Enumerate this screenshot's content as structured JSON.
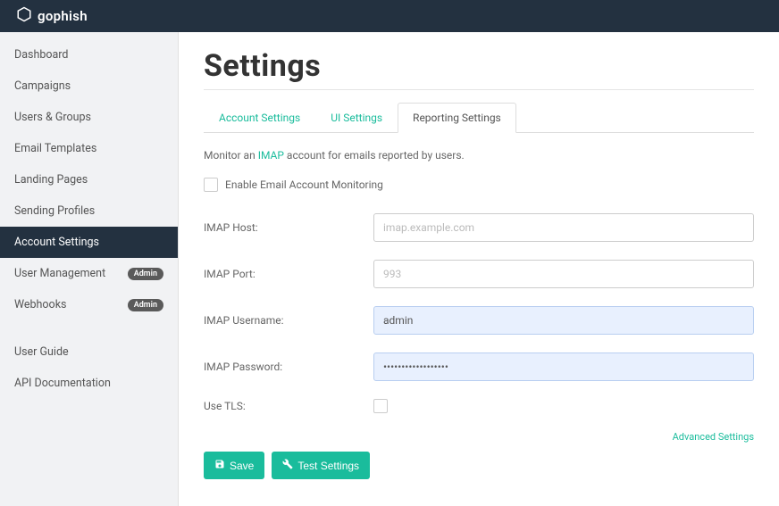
{
  "brand": "gophish",
  "sidebar": {
    "items": [
      {
        "label": "Dashboard"
      },
      {
        "label": "Campaigns"
      },
      {
        "label": "Users & Groups"
      },
      {
        "label": "Email Templates"
      },
      {
        "label": "Landing Pages"
      },
      {
        "label": "Sending Profiles"
      },
      {
        "label": "Account Settings"
      },
      {
        "label": "User Management",
        "badge": "Admin"
      },
      {
        "label": "Webhooks",
        "badge": "Admin"
      },
      {
        "label": "User Guide"
      },
      {
        "label": "API Documentation"
      }
    ]
  },
  "page": {
    "title": "Settings"
  },
  "tabs": [
    {
      "label": "Account Settings"
    },
    {
      "label": "UI Settings"
    },
    {
      "label": "Reporting Settings"
    }
  ],
  "reporting": {
    "help_prefix": "Monitor an ",
    "help_link": "IMAP",
    "help_suffix": " account for emails reported by users.",
    "enable_label": "Enable Email Account Monitoring",
    "host_label": "IMAP Host:",
    "host_placeholder": "imap.example.com",
    "host_value": "",
    "port_label": "IMAP Port:",
    "port_placeholder": "993",
    "port_value": "",
    "username_label": "IMAP Username:",
    "username_value": "admin",
    "password_label": "IMAP Password:",
    "password_value": "••••••••••••••••••",
    "tls_label": "Use TLS:",
    "advanced_link": "Advanced Settings",
    "save_label": "Save",
    "test_label": "Test Settings"
  }
}
